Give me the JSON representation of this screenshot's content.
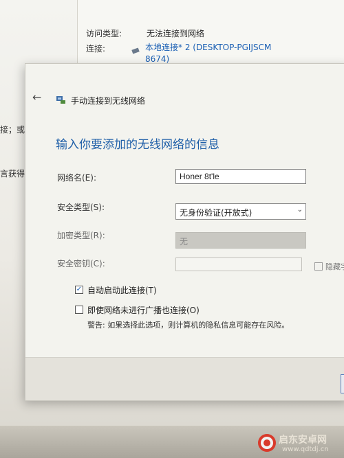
{
  "background": {
    "access_type_label": "访问类型:",
    "access_type_value": "无法连接到网络",
    "connection_label": "连接:",
    "connection_link_line1": "本地连接* 2 (DESKTOP-PGIJSCM",
    "connection_link_line2": "8674)",
    "left_fragment_1": "接；或",
    "left_fragment_2": "言获得腿"
  },
  "dialog": {
    "title": "手动连接到无线网络",
    "heading": "输入你要添加的无线网络的信息",
    "network_name_label": "网络名(E):",
    "network_name_value": "Honer 8t'le",
    "security_type_label": "安全类型(S):",
    "security_type_value": "无身份验证(开放式)",
    "encryption_type_label": "加密类型(R):",
    "encryption_type_value": "无",
    "security_key_label": "安全密钥(C):",
    "hide_chars_label": "隐藏字",
    "auto_start_label": "自动启动此连接(T)",
    "auto_start_checked": true,
    "connect_hidden_label": "即使网络未进行广播也连接(O)",
    "connect_hidden_checked": false,
    "warning_text": "警告: 如果选择此选项，则计算机的隐私信息可能存在风险。"
  },
  "watermark": {
    "name": "启东安卓网",
    "url": "www.qdtdj.cn"
  },
  "colors": {
    "heading_blue": "#1f5fa8",
    "link_blue": "#1a5fb4",
    "watermark_red": "#d93a2b"
  }
}
